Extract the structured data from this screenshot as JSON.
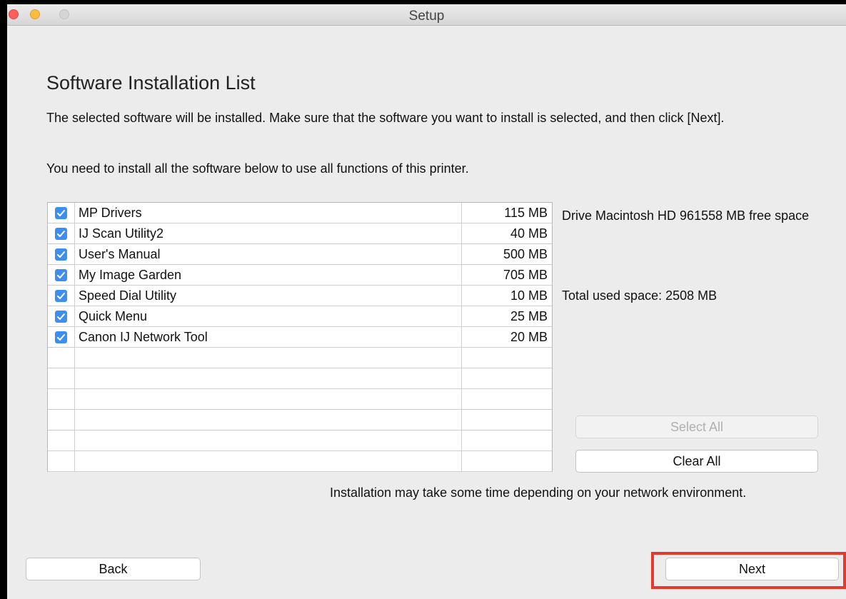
{
  "window": {
    "title": "Setup"
  },
  "page": {
    "heading": "Software Installation List",
    "description": "The selected software will be installed. Make sure that the software you want to install is selected, and then click [Next].",
    "requirement": "You need to install all the software below to use all functions of this printer."
  },
  "software": [
    {
      "name": "MP Drivers",
      "size": "115 MB",
      "checked": true
    },
    {
      "name": "IJ Scan Utility2",
      "size": "40 MB",
      "checked": true
    },
    {
      "name": "User's Manual",
      "size": "500 MB",
      "checked": true
    },
    {
      "name": "My Image Garden",
      "size": "705 MB",
      "checked": true
    },
    {
      "name": "Speed Dial Utility",
      "size": "10 MB",
      "checked": true
    },
    {
      "name": "Quick Menu",
      "size": "25 MB",
      "checked": true
    },
    {
      "name": "Canon IJ Network Tool",
      "size": "20 MB",
      "checked": true
    }
  ],
  "info": {
    "drive": "Drive Macintosh HD 961558 MB free space",
    "total_used": "Total used space: 2508 MB"
  },
  "buttons": {
    "select_all": "Select All",
    "clear_all": "Clear All",
    "back": "Back",
    "next": "Next"
  },
  "note": "Installation may take some time depending on your network environment.",
  "colors": {
    "checkbox": "#3d8ef3",
    "highlight": "#e33a2b"
  }
}
